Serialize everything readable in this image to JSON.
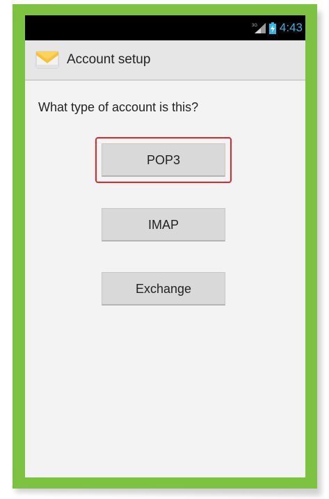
{
  "status_bar": {
    "time": "4:43",
    "signal_icon": "signal-icon",
    "battery_icon": "battery-icon",
    "time_color": "#33b5e5"
  },
  "action_bar": {
    "app_icon": "email-icon",
    "title": "Account setup"
  },
  "main": {
    "question": "What type of account is this?",
    "options": [
      {
        "label": "POP3",
        "highlighted": true
      },
      {
        "label": "IMAP",
        "highlighted": false
      },
      {
        "label": "Exchange",
        "highlighted": false
      }
    ]
  },
  "colors": {
    "frame": "#7dc241",
    "highlight": "#e0262a",
    "status_bar_bg": "#000000"
  }
}
